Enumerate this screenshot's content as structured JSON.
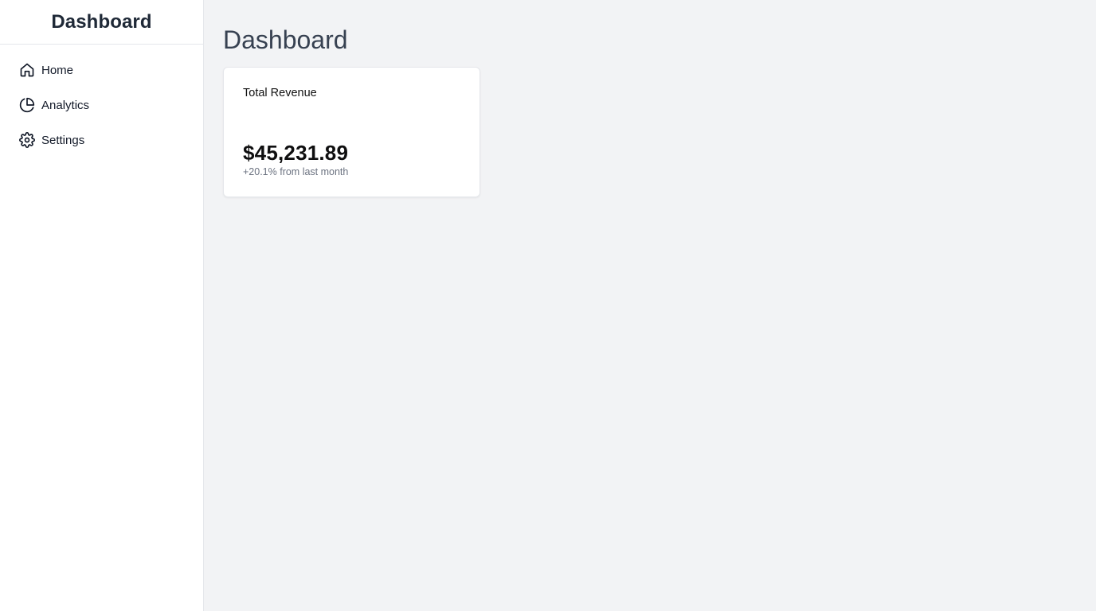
{
  "sidebar": {
    "title": "Dashboard",
    "items": [
      {
        "label": "Home",
        "icon": "home-icon"
      },
      {
        "label": "Analytics",
        "icon": "pie-chart-icon"
      },
      {
        "label": "Settings",
        "icon": "gear-icon"
      }
    ]
  },
  "main": {
    "title": "Dashboard",
    "card": {
      "title": "Total Revenue",
      "value": "$45,231.89",
      "subtitle": "+20.1% from last month"
    }
  },
  "colors": {
    "background": "#f2f3f5",
    "sidebar": "#ffffff",
    "border": "#e5e7eb",
    "muted_text": "#6b7280",
    "title_text": "#374151"
  }
}
